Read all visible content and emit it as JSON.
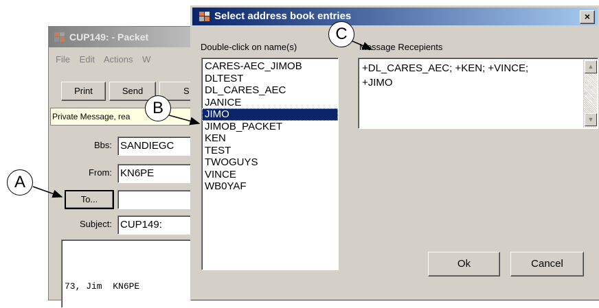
{
  "background_window": {
    "title": "CUP149: - Packet",
    "menu": [
      "File",
      "Edit",
      "Actions",
      "W"
    ],
    "toolbar": {
      "print": "Print",
      "send": "Send",
      "third": "S"
    },
    "notice": "Private Message, rea",
    "fields": {
      "bbs_label": "Bbs:",
      "bbs_value": "SANDIEGC",
      "from_label": "From:",
      "from_value": "KN6PE",
      "to_button": "To...",
      "to_value": "",
      "subject_label": "Subject:",
      "subject_value": "CUP149:"
    },
    "body_text": "73, Jim  KN6PE"
  },
  "dialog": {
    "title": "Select address book entries",
    "close": "×",
    "left_label": "Double-click on name(s)",
    "right_label": "Message Recepients",
    "names": [
      "CARES-AEC_JIMOB",
      "DLTEST",
      "DL_CARES_AEC",
      "JANICE",
      "JIMO",
      "JIMOB_PACKET",
      "KEN",
      "TEST",
      "TWOGUYS",
      "VINCE",
      "WB0YAF"
    ],
    "selected_index": 4,
    "recipients_line1": "+DL_CARES_AEC; +KEN; +VINCE;",
    "recipients_line2": "+JIMO",
    "ok": "Ok",
    "cancel": "Cancel"
  },
  "callouts": {
    "a": "A",
    "b": "B",
    "c": "C"
  }
}
